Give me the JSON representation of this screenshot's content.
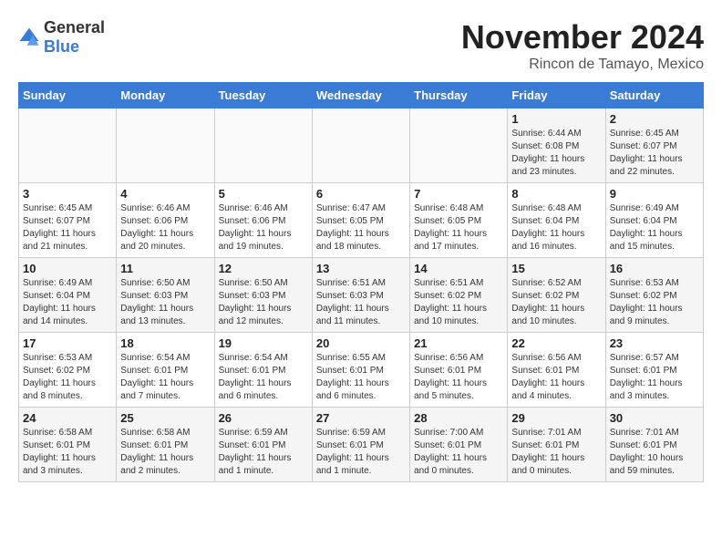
{
  "logo": {
    "general": "General",
    "blue": "Blue"
  },
  "title": "November 2024",
  "location": "Rincon de Tamayo, Mexico",
  "days_of_week": [
    "Sunday",
    "Monday",
    "Tuesday",
    "Wednesday",
    "Thursday",
    "Friday",
    "Saturday"
  ],
  "weeks": [
    [
      {
        "day": "",
        "info": ""
      },
      {
        "day": "",
        "info": ""
      },
      {
        "day": "",
        "info": ""
      },
      {
        "day": "",
        "info": ""
      },
      {
        "day": "",
        "info": ""
      },
      {
        "day": "1",
        "info": "Sunrise: 6:44 AM\nSunset: 6:08 PM\nDaylight: 11 hours and 23 minutes."
      },
      {
        "day": "2",
        "info": "Sunrise: 6:45 AM\nSunset: 6:07 PM\nDaylight: 11 hours and 22 minutes."
      }
    ],
    [
      {
        "day": "3",
        "info": "Sunrise: 6:45 AM\nSunset: 6:07 PM\nDaylight: 11 hours and 21 minutes."
      },
      {
        "day": "4",
        "info": "Sunrise: 6:46 AM\nSunset: 6:06 PM\nDaylight: 11 hours and 20 minutes."
      },
      {
        "day": "5",
        "info": "Sunrise: 6:46 AM\nSunset: 6:06 PM\nDaylight: 11 hours and 19 minutes."
      },
      {
        "day": "6",
        "info": "Sunrise: 6:47 AM\nSunset: 6:05 PM\nDaylight: 11 hours and 18 minutes."
      },
      {
        "day": "7",
        "info": "Sunrise: 6:48 AM\nSunset: 6:05 PM\nDaylight: 11 hours and 17 minutes."
      },
      {
        "day": "8",
        "info": "Sunrise: 6:48 AM\nSunset: 6:04 PM\nDaylight: 11 hours and 16 minutes."
      },
      {
        "day": "9",
        "info": "Sunrise: 6:49 AM\nSunset: 6:04 PM\nDaylight: 11 hours and 15 minutes."
      }
    ],
    [
      {
        "day": "10",
        "info": "Sunrise: 6:49 AM\nSunset: 6:04 PM\nDaylight: 11 hours and 14 minutes."
      },
      {
        "day": "11",
        "info": "Sunrise: 6:50 AM\nSunset: 6:03 PM\nDaylight: 11 hours and 13 minutes."
      },
      {
        "day": "12",
        "info": "Sunrise: 6:50 AM\nSunset: 6:03 PM\nDaylight: 11 hours and 12 minutes."
      },
      {
        "day": "13",
        "info": "Sunrise: 6:51 AM\nSunset: 6:03 PM\nDaylight: 11 hours and 11 minutes."
      },
      {
        "day": "14",
        "info": "Sunrise: 6:51 AM\nSunset: 6:02 PM\nDaylight: 11 hours and 10 minutes."
      },
      {
        "day": "15",
        "info": "Sunrise: 6:52 AM\nSunset: 6:02 PM\nDaylight: 11 hours and 10 minutes."
      },
      {
        "day": "16",
        "info": "Sunrise: 6:53 AM\nSunset: 6:02 PM\nDaylight: 11 hours and 9 minutes."
      }
    ],
    [
      {
        "day": "17",
        "info": "Sunrise: 6:53 AM\nSunset: 6:02 PM\nDaylight: 11 hours and 8 minutes."
      },
      {
        "day": "18",
        "info": "Sunrise: 6:54 AM\nSunset: 6:01 PM\nDaylight: 11 hours and 7 minutes."
      },
      {
        "day": "19",
        "info": "Sunrise: 6:54 AM\nSunset: 6:01 PM\nDaylight: 11 hours and 6 minutes."
      },
      {
        "day": "20",
        "info": "Sunrise: 6:55 AM\nSunset: 6:01 PM\nDaylight: 11 hours and 6 minutes."
      },
      {
        "day": "21",
        "info": "Sunrise: 6:56 AM\nSunset: 6:01 PM\nDaylight: 11 hours and 5 minutes."
      },
      {
        "day": "22",
        "info": "Sunrise: 6:56 AM\nSunset: 6:01 PM\nDaylight: 11 hours and 4 minutes."
      },
      {
        "day": "23",
        "info": "Sunrise: 6:57 AM\nSunset: 6:01 PM\nDaylight: 11 hours and 3 minutes."
      }
    ],
    [
      {
        "day": "24",
        "info": "Sunrise: 6:58 AM\nSunset: 6:01 PM\nDaylight: 11 hours and 3 minutes."
      },
      {
        "day": "25",
        "info": "Sunrise: 6:58 AM\nSunset: 6:01 PM\nDaylight: 11 hours and 2 minutes."
      },
      {
        "day": "26",
        "info": "Sunrise: 6:59 AM\nSunset: 6:01 PM\nDaylight: 11 hours and 1 minute."
      },
      {
        "day": "27",
        "info": "Sunrise: 6:59 AM\nSunset: 6:01 PM\nDaylight: 11 hours and 1 minute."
      },
      {
        "day": "28",
        "info": "Sunrise: 7:00 AM\nSunset: 6:01 PM\nDaylight: 11 hours and 0 minutes."
      },
      {
        "day": "29",
        "info": "Sunrise: 7:01 AM\nSunset: 6:01 PM\nDaylight: 11 hours and 0 minutes."
      },
      {
        "day": "30",
        "info": "Sunrise: 7:01 AM\nSunset: 6:01 PM\nDaylight: 10 hours and 59 minutes."
      }
    ]
  ]
}
